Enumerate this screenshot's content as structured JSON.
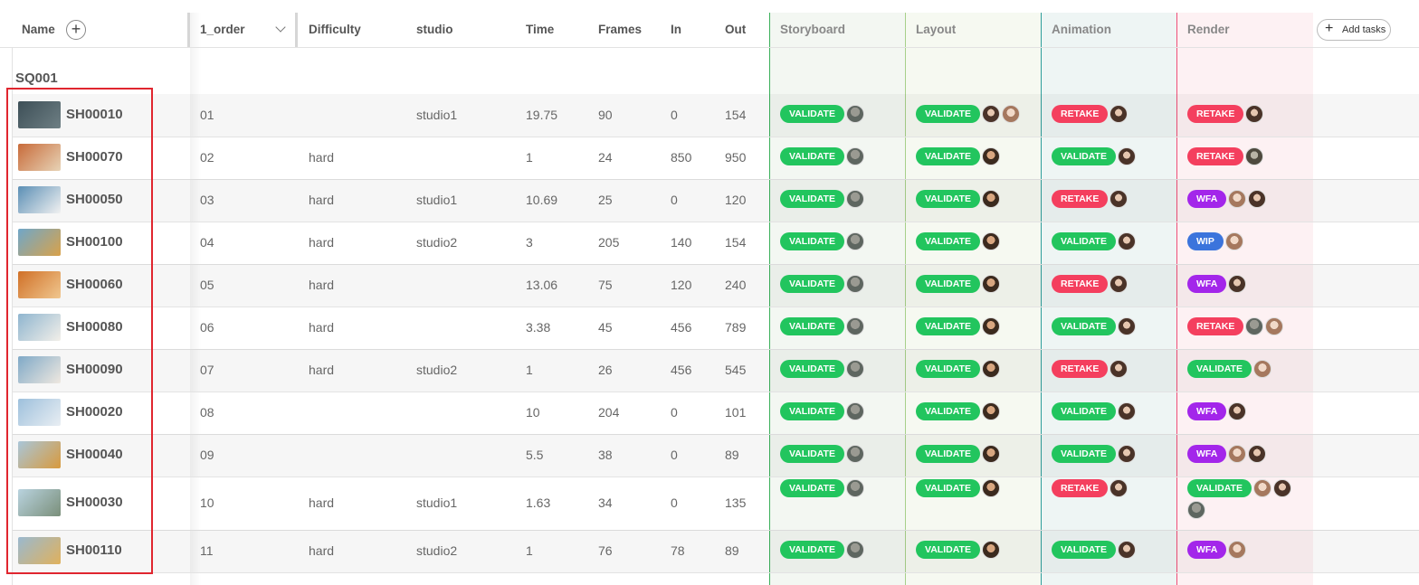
{
  "header": {
    "name": "Name",
    "add_column": "+",
    "order": "1_order",
    "difficulty": "Difficulty",
    "studio": "studio",
    "time": "Time",
    "frames": "Frames",
    "in": "In",
    "out": "Out",
    "tasks": [
      "Storyboard",
      "Layout",
      "Animation",
      "Render"
    ],
    "add_tasks": "Add tasks",
    "add_tasks_icon": "+"
  },
  "sequence": "SQ001",
  "colors": {
    "validate": "#22c55e",
    "retake": "#f43f5e",
    "wfa": "#a326ea",
    "wip": "#3b74dc",
    "selection_box": "#e0262f"
  },
  "rows": [
    {
      "name": "SH00010",
      "order": "01",
      "difficulty": "",
      "studio": "studio1",
      "time": "19.75",
      "frames": "90",
      "in": "0",
      "out": "154",
      "thumb": [
        "#3d4f57",
        "#6e7f84"
      ],
      "tasks": [
        {
          "status": "VALIDATE",
          "avatars": [
            "gray"
          ]
        },
        {
          "status": "VALIDATE",
          "avatars": [
            "dark",
            "light"
          ]
        },
        {
          "status": "RETAKE",
          "avatars": [
            "dark"
          ]
        },
        {
          "status": "RETAKE",
          "avatars": [
            "dark"
          ]
        }
      ]
    },
    {
      "name": "SH00070",
      "order": "02",
      "difficulty": "hard",
      "studio": "",
      "time": "1",
      "frames": "24",
      "in": "850",
      "out": "950",
      "thumb": [
        "#c86b3a",
        "#e7d3b6"
      ],
      "tasks": [
        {
          "status": "VALIDATE",
          "avatars": [
            "gray"
          ]
        },
        {
          "status": "VALIDATE",
          "avatars": [
            "brown"
          ]
        },
        {
          "status": "VALIDATE",
          "avatars": [
            "dark"
          ]
        },
        {
          "status": "RETAKE",
          "avatars": [
            "gray2"
          ]
        }
      ]
    },
    {
      "name": "SH00050",
      "order": "03",
      "difficulty": "hard",
      "studio": "studio1",
      "time": "10.69",
      "frames": "25",
      "in": "0",
      "out": "120",
      "thumb": [
        "#5b8fb5",
        "#f1f1f1"
      ],
      "tasks": [
        {
          "status": "VALIDATE",
          "avatars": [
            "gray"
          ]
        },
        {
          "status": "VALIDATE",
          "avatars": [
            "brown"
          ]
        },
        {
          "status": "RETAKE",
          "avatars": [
            "dark"
          ]
        },
        {
          "status": "WFA",
          "avatars": [
            "light",
            "dark"
          ]
        }
      ]
    },
    {
      "name": "SH00100",
      "order": "04",
      "difficulty": "hard",
      "studio": "studio2",
      "time": "3",
      "frames": "205",
      "in": "140",
      "out": "154",
      "thumb": [
        "#6fa7c9",
        "#d9a24a"
      ],
      "tasks": [
        {
          "status": "VALIDATE",
          "avatars": [
            "gray"
          ]
        },
        {
          "status": "VALIDATE",
          "avatars": [
            "brown"
          ]
        },
        {
          "status": "VALIDATE",
          "avatars": [
            "dark"
          ]
        },
        {
          "status": "WIP",
          "avatars": [
            "light"
          ]
        }
      ]
    },
    {
      "name": "SH00060",
      "order": "05",
      "difficulty": "hard",
      "studio": "",
      "time": "13.06",
      "frames": "75",
      "in": "120",
      "out": "240",
      "thumb": [
        "#d07027",
        "#f0c78f"
      ],
      "tasks": [
        {
          "status": "VALIDATE",
          "avatars": [
            "gray"
          ]
        },
        {
          "status": "VALIDATE",
          "avatars": [
            "brown"
          ]
        },
        {
          "status": "RETAKE",
          "avatars": [
            "dark"
          ]
        },
        {
          "status": "WFA",
          "avatars": [
            "dark"
          ]
        }
      ]
    },
    {
      "name": "SH00080",
      "order": "06",
      "difficulty": "hard",
      "studio": "",
      "time": "3.38",
      "frames": "45",
      "in": "456",
      "out": "789",
      "thumb": [
        "#8fb5cf",
        "#f2efe9"
      ],
      "tasks": [
        {
          "status": "VALIDATE",
          "avatars": [
            "gray"
          ]
        },
        {
          "status": "VALIDATE",
          "avatars": [
            "brown"
          ]
        },
        {
          "status": "VALIDATE",
          "avatars": [
            "dark"
          ]
        },
        {
          "status": "RETAKE",
          "avatars": [
            "gray",
            "light"
          ]
        }
      ]
    },
    {
      "name": "SH00090",
      "order": "07",
      "difficulty": "hard",
      "studio": "studio2",
      "time": "1",
      "frames": "26",
      "in": "456",
      "out": "545",
      "thumb": [
        "#7fa9c7",
        "#efe8e0"
      ],
      "tasks": [
        {
          "status": "VALIDATE",
          "avatars": [
            "gray"
          ]
        },
        {
          "status": "VALIDATE",
          "avatars": [
            "brown"
          ]
        },
        {
          "status": "RETAKE",
          "avatars": [
            "dark"
          ]
        },
        {
          "status": "VALIDATE",
          "avatars": [
            "light"
          ]
        }
      ]
    },
    {
      "name": "SH00020",
      "order": "08",
      "difficulty": "",
      "studio": "",
      "time": "10",
      "frames": "204",
      "in": "0",
      "out": "101",
      "thumb": [
        "#9dc0dc",
        "#e9eef3"
      ],
      "tasks": [
        {
          "status": "VALIDATE",
          "avatars": [
            "gray"
          ]
        },
        {
          "status": "VALIDATE",
          "avatars": [
            "brown"
          ]
        },
        {
          "status": "VALIDATE",
          "avatars": [
            "dark"
          ]
        },
        {
          "status": "WFA",
          "avatars": [
            "dark"
          ]
        }
      ]
    },
    {
      "name": "SH00040",
      "order": "09",
      "difficulty": "",
      "studio": "",
      "time": "5.5",
      "frames": "38",
      "in": "0",
      "out": "89",
      "thumb": [
        "#a9c6d9",
        "#d89a3e"
      ],
      "tasks": [
        {
          "status": "VALIDATE",
          "avatars": [
            "gray"
          ]
        },
        {
          "status": "VALIDATE",
          "avatars": [
            "brown"
          ]
        },
        {
          "status": "VALIDATE",
          "avatars": [
            "dark"
          ]
        },
        {
          "status": "WFA",
          "avatars": [
            "light",
            "dark"
          ]
        }
      ]
    },
    {
      "name": "SH00030",
      "order": "10",
      "difficulty": "hard",
      "studio": "studio1",
      "time": "1.63",
      "frames": "34",
      "in": "0",
      "out": "135",
      "thumb": [
        "#b9d3df",
        "#7a8f7a"
      ],
      "tasks": [
        {
          "status": "VALIDATE",
          "avatars": [
            "gray"
          ]
        },
        {
          "status": "VALIDATE",
          "avatars": [
            "brown"
          ]
        },
        {
          "status": "RETAKE",
          "avatars": [
            "dark"
          ]
        },
        {
          "status": "VALIDATE",
          "avatars": [
            "light",
            "dark"
          ],
          "extra_avatars": [
            "gray"
          ]
        }
      ]
    },
    {
      "name": "SH00110",
      "order": "11",
      "difficulty": "hard",
      "studio": "studio2",
      "time": "1",
      "frames": "76",
      "in": "78",
      "out": "89",
      "thumb": [
        "#9ab9cf",
        "#e0b15c"
      ],
      "tasks": [
        {
          "status": "VALIDATE",
          "avatars": [
            "gray"
          ]
        },
        {
          "status": "VALIDATE",
          "avatars": [
            "brown"
          ]
        },
        {
          "status": "VALIDATE",
          "avatars": [
            "dark"
          ]
        },
        {
          "status": "WFA",
          "avatars": [
            "light"
          ]
        }
      ]
    }
  ]
}
